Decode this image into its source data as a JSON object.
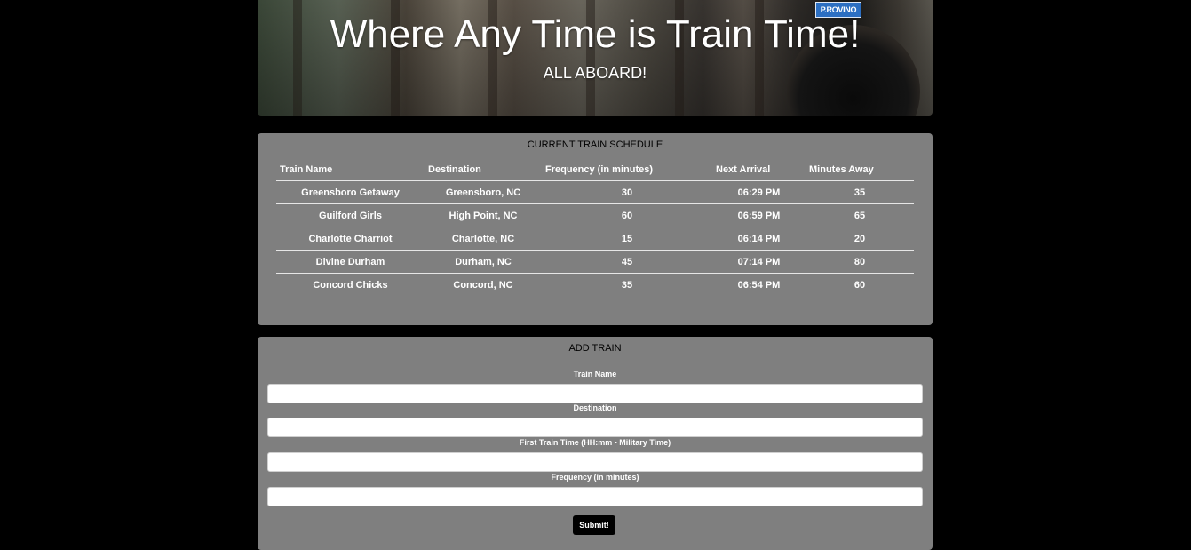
{
  "header": {
    "title": "Where Any Time is Train Time!",
    "subtitle": "ALL ABOARD!",
    "sign_text": "P.ROVINO"
  },
  "schedule": {
    "title": "CURRENT TRAIN SCHEDULE",
    "columns": [
      "Train Name",
      "Destination",
      "Frequency (in minutes)",
      "Next Arrival",
      "Minutes Away"
    ],
    "rows": [
      [
        "Greensboro Getaway",
        "Greensboro, NC",
        "30",
        "06:29 PM",
        "35"
      ],
      [
        "Guilford Girls",
        "High Point, NC",
        "60",
        "06:59 PM",
        "65"
      ],
      [
        "Charlotte Charriot",
        "Charlotte, NC",
        "15",
        "06:14 PM",
        "20"
      ],
      [
        "Divine Durham",
        "Durham, NC",
        "45",
        "07:14 PM",
        "80"
      ],
      [
        "Concord Chicks",
        "Concord, NC",
        "35",
        "06:54 PM",
        "60"
      ]
    ]
  },
  "add_train": {
    "title": "ADD TRAIN",
    "fields": [
      {
        "label": "Train Name",
        "value": "",
        "placeholder": ""
      },
      {
        "label": "Destination",
        "value": "",
        "placeholder": ""
      },
      {
        "label": "First Train Time (HH:mm - Military Time)",
        "value": "",
        "placeholder": ""
      },
      {
        "label": "Frequency (in minutes)",
        "value": "",
        "placeholder": ""
      }
    ],
    "submit_label": "Submit!"
  },
  "colors": {
    "page_background": "#000000",
    "panel_background": "#7f7f7f",
    "button_background": "#000000",
    "sign_background": "#2c6fc2"
  }
}
